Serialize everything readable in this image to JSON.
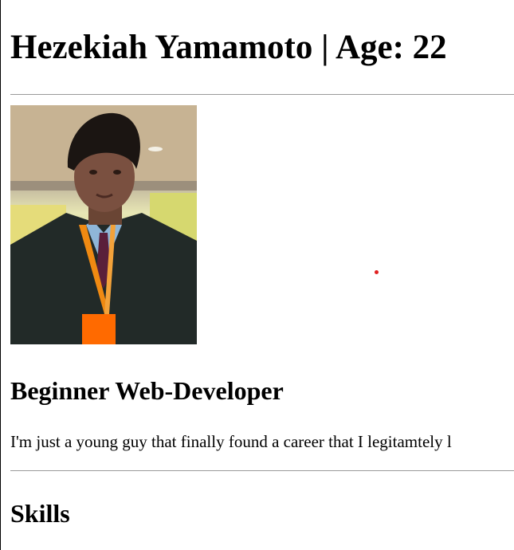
{
  "header": {
    "title": "Hezekiah Yamamoto | Age: 22"
  },
  "profile_photo": {
    "icon": "person-photo"
  },
  "intro": {
    "role": "Beginner Web-Developer",
    "bio": "I'm just a young guy that finally found a career that I legitamtely l"
  },
  "sections": {
    "skills": "Skills"
  },
  "colors": {
    "rule": "#9a9a9a",
    "dot": "#e02020"
  }
}
